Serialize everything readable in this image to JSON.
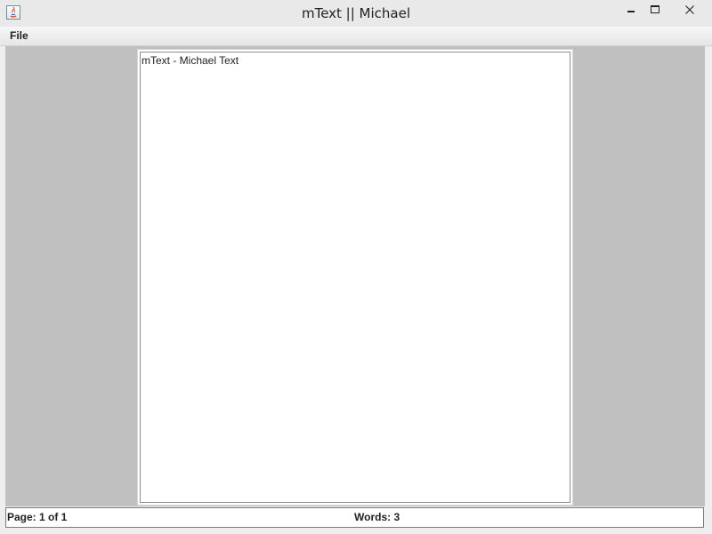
{
  "window": {
    "title": "mText || Michael",
    "icon": "java-app-icon"
  },
  "menubar": {
    "items": [
      {
        "label": "File"
      }
    ]
  },
  "document": {
    "text": "mText - Michael Text"
  },
  "statusbar": {
    "page": "Page: 1 of 1",
    "words": "Words: 3"
  },
  "colors": {
    "workspace_background": "#c0c0c0",
    "page_background": "#ffffff",
    "titlebar_background": "#e9e9e9",
    "close_button_hover": "#c7c7c7"
  }
}
